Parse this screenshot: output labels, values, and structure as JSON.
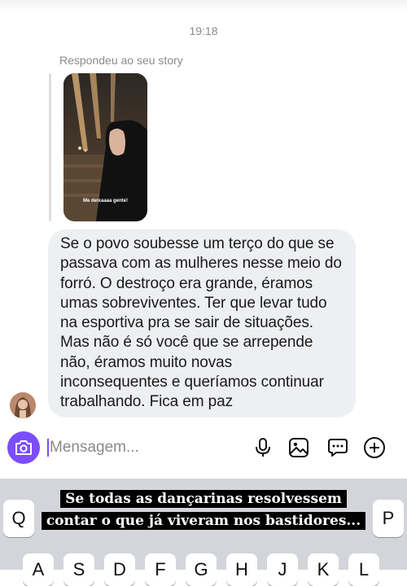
{
  "thread": {
    "timestamp": "19:18",
    "story_reply_label": "Respondeu ao seu story",
    "story_overlay_text": "Me deixaaaa gente!",
    "message_text": "Se o povo soubesse um terço do que se\npassava com as mulheres nesse meio do\nforró. O destroço era grande, éramos\numas sobreviventes. Ter que levar tudo\nna esportiva pra se sair de situações.\nMas não é só você que se arrepende\nnão, éramos muito novas\ninconsequentes e queríamos continuar\ntrabalhando. Fica em paz"
  },
  "composer": {
    "placeholder": "Mensagem...",
    "camera_icon": "camera-icon",
    "mic_icon": "microphone-icon",
    "gallery_icon": "image-icon",
    "sticker_icon": "chat-sticker-icon",
    "add_icon": "plus-circle-icon",
    "accent_color": "#7c4dff"
  },
  "keyboard": {
    "row1_visible": [
      "Q",
      "P"
    ],
    "row2_visible": [
      "A",
      "S",
      "D",
      "F",
      "G",
      "H",
      "J",
      "K",
      "L"
    ]
  },
  "caption_overlay": {
    "line1": "Se todas as dançarinas resolvessem",
    "line2": "contar o que já viveram nos bastidores..."
  }
}
